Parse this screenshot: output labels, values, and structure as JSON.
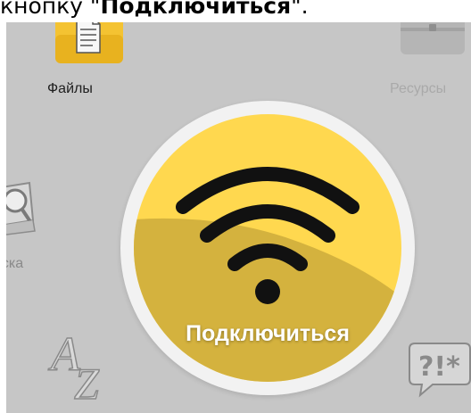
{
  "caption": {
    "prefix": "кнопку \"",
    "bold": "Подключиться",
    "suffix": "\"."
  },
  "apps": {
    "files": {
      "label": "Файлы",
      "icon": "folder-documents-icon"
    },
    "resources": {
      "label": "Ресурсы",
      "icon": "briefcase-icon"
    },
    "search": {
      "label": "оска",
      "icon": "magnifier-icon"
    },
    "alphabet": {
      "icon": "az-letters-icon"
    },
    "help": {
      "icon": "question-bubble-icon"
    }
  },
  "connect": {
    "label": "Подключиться",
    "icon": "wifi-icon"
  },
  "colors": {
    "screen_bg": "#c6c6c6",
    "disc_light": "#ffd84f",
    "disc_dark": "#d4b23e",
    "ring": "#f2f2f2",
    "wifi": "#111111"
  }
}
